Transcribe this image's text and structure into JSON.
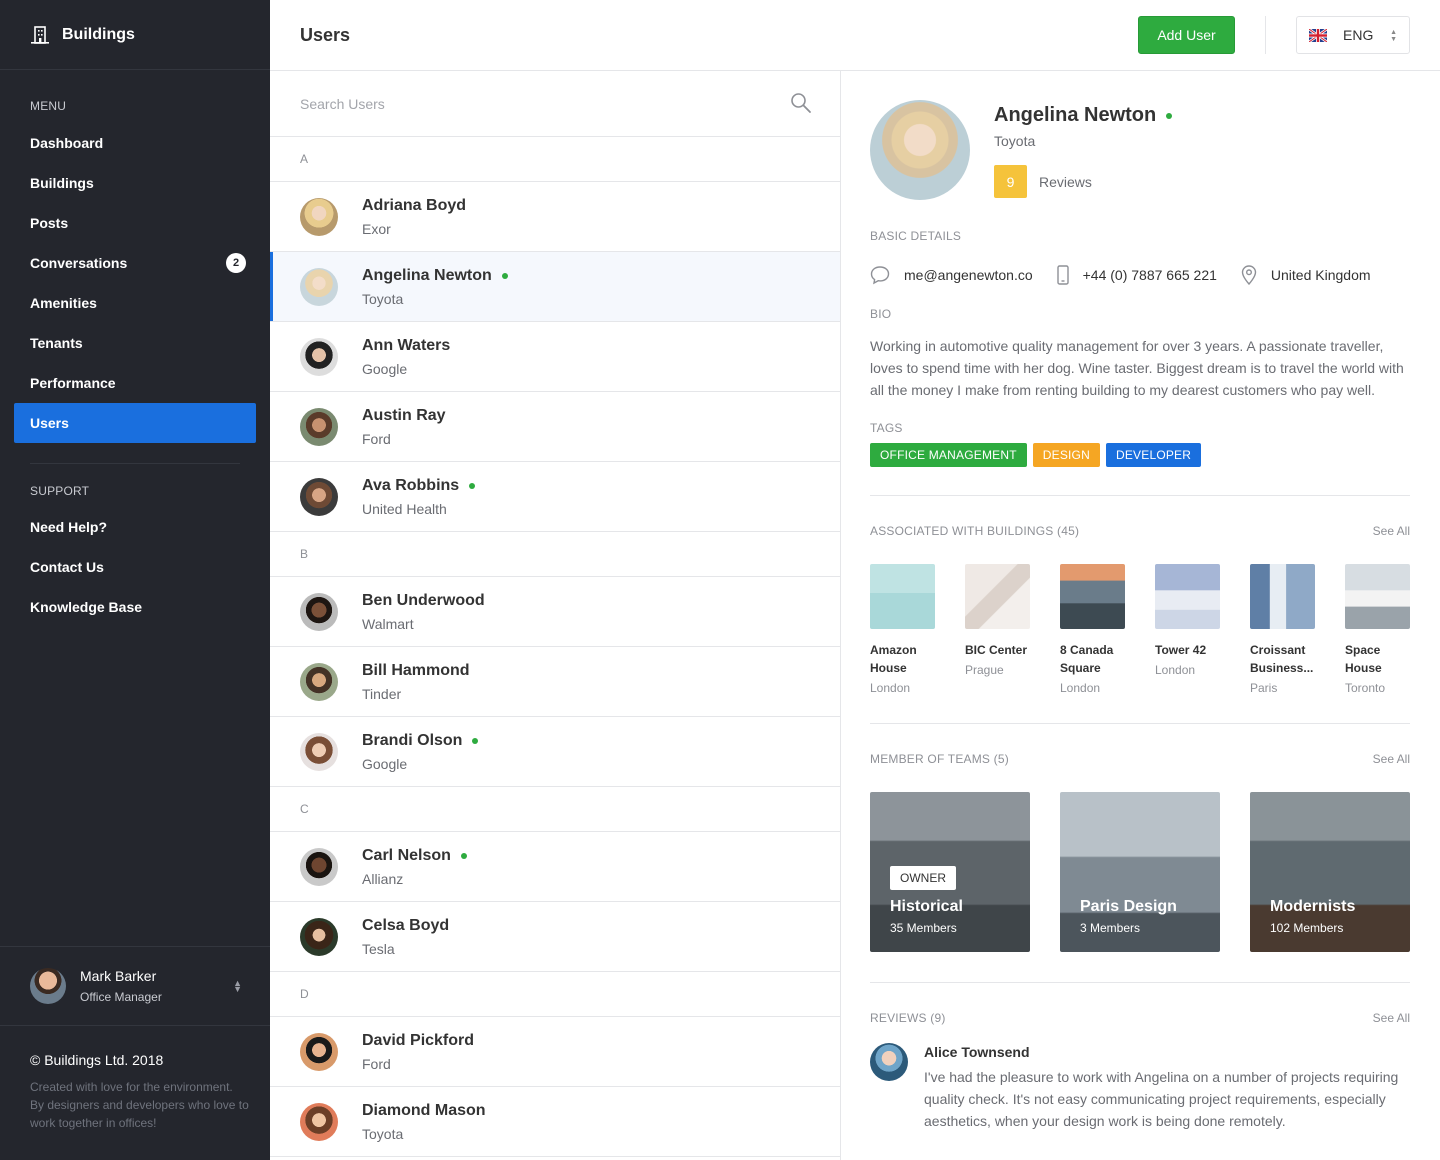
{
  "brand": {
    "name": "Buildings"
  },
  "sidebar": {
    "menu_label": "MENU",
    "menu_items": [
      {
        "label": "Dashboard"
      },
      {
        "label": "Buildings"
      },
      {
        "label": "Posts"
      },
      {
        "label": "Conversations",
        "badge": "2"
      },
      {
        "label": "Amenities"
      },
      {
        "label": "Tenants"
      },
      {
        "label": "Performance"
      },
      {
        "label": "Users",
        "active": true
      }
    ],
    "support_label": "SUPPORT",
    "support_items": [
      {
        "label": "Need Help?"
      },
      {
        "label": "Contact Us"
      },
      {
        "label": "Knowledge Base"
      }
    ],
    "profile": {
      "name": "Mark Barker",
      "role": "Office Manager"
    },
    "footer": {
      "copyright": "© Buildings Ltd. 2018",
      "note": "Created with love for the environment. By designers and developers who love to work together in offices!"
    }
  },
  "header": {
    "title": "Users",
    "add_user_label": "Add User",
    "language": "ENG"
  },
  "search": {
    "placeholder": "Search Users",
    "value": ""
  },
  "user_list": {
    "groups": [
      {
        "letter": "A",
        "users": [
          {
            "name": "Adriana Boyd",
            "company": "Exor",
            "online": false
          },
          {
            "name": "Angelina Newton",
            "company": "Toyota",
            "online": true,
            "selected": true
          },
          {
            "name": "Ann Waters",
            "company": "Google",
            "online": false
          },
          {
            "name": "Austin Ray",
            "company": "Ford",
            "online": false
          },
          {
            "name": "Ava Robbins",
            "company": "United Health",
            "online": true
          }
        ]
      },
      {
        "letter": "B",
        "users": [
          {
            "name": "Ben Underwood",
            "company": "Walmart",
            "online": false
          },
          {
            "name": "Bill Hammond",
            "company": "Tinder",
            "online": false
          },
          {
            "name": "Brandi Olson",
            "company": "Google",
            "online": true
          }
        ]
      },
      {
        "letter": "C",
        "users": [
          {
            "name": "Carl Nelson",
            "company": "Allianz",
            "online": true
          },
          {
            "name": "Celsa Boyd",
            "company": "Tesla",
            "online": false
          }
        ]
      },
      {
        "letter": "D",
        "users": [
          {
            "name": "David Pickford",
            "company": "Ford",
            "online": false
          },
          {
            "name": "Diamond Mason",
            "company": "Toyota",
            "online": false
          }
        ]
      }
    ]
  },
  "detail": {
    "name": "Angelina Newton",
    "company": "Toyota",
    "online": true,
    "reviews_count": "9",
    "reviews_label": "Reviews",
    "basic_details_label": "BASIC DETAILS",
    "email": "me@angenewton.co",
    "phone": "+44 (0) 7887 665 221",
    "location": "United Kingdom",
    "bio_label": "BIO",
    "bio": "Working in automotive quality management for over 3 years. A passionate traveller, loves to spend time with her dog. Wine taster. Biggest dream is to travel the world with all the money I make from renting building to my dearest customers who pay well.",
    "tags_label": "TAGS",
    "tags": [
      {
        "label": "OFFICE MANAGEMENT",
        "color": "#2eab3f"
      },
      {
        "label": "DESIGN",
        "color": "#f5a623"
      },
      {
        "label": "DEVELOPER",
        "color": "#1a6fde"
      }
    ],
    "buildings_label": "ASSOCIATED WITH BUILDINGS (45)",
    "see_all_label": "See All",
    "buildings": [
      {
        "name": "Amazon House",
        "city": "London"
      },
      {
        "name": "BIC Center",
        "city": "Prague"
      },
      {
        "name": "8 Canada Square",
        "city": "London"
      },
      {
        "name": "Tower 42",
        "city": "London"
      },
      {
        "name": "Croissant Business...",
        "city": "Paris"
      },
      {
        "name": "Space House",
        "city": "Toronto"
      }
    ],
    "teams_label": "MEMBER OF TEAMS (5)",
    "teams": [
      {
        "name": "Historical",
        "members": "35 Members",
        "role": "OWNER"
      },
      {
        "name": "Paris Design",
        "members": "3 Members"
      },
      {
        "name": "Modernists",
        "members": "102 Members"
      }
    ],
    "reviews_section_label": "REVIEWS (9)",
    "review": {
      "author": "Alice Townsend",
      "text": "I've had the pleasure to work with Angelina on a number of projects requiring quality check. It's not easy communicating project requirements, especially aesthetics, when your design work is being done remotely."
    }
  }
}
